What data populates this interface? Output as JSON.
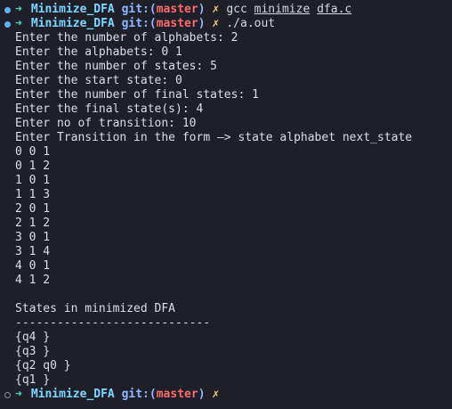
{
  "prompt": {
    "arrow": "➜",
    "dir": "Minimize_DFA",
    "git_label": "git:",
    "open_paren": "(",
    "branch": "master",
    "close_paren": ")",
    "cross": "✗"
  },
  "cmd1": {
    "gcc": "gcc",
    "arg1": "minimize",
    "arg2": "dfa.c"
  },
  "cmd2": {
    "run": "./a.out"
  },
  "output": {
    "l1": "Enter the number of alphabets: 2",
    "l2": "Enter the alphabets: 0 1",
    "l3": "Enter the number of states: 5",
    "l4": "Enter the start state: 0",
    "l5": "Enter the number of final states: 1",
    "l6": "Enter the final state(s): 4",
    "l7": "Enter no of transition: 10",
    "l8": "Enter Transition in the form –> state alphabet next_state",
    "t1": "0 0 1",
    "t2": "0 1 2",
    "t3": "1 0 1",
    "t4": "1 1 3",
    "t5": "2 0 1",
    "t6": "2 1 2",
    "t7": "3 0 1",
    "t8": "3 1 4",
    "t9": "4 0 1",
    "t10": "4 1 2",
    "states_header": "States in minimized DFA",
    "separator": "----------------------------",
    "s1": "{q4 }",
    "s2": "{q3 }",
    "s3": "{q2 q0 }",
    "s4": "{q1 }"
  },
  "colors": {
    "background": "#1e1f28",
    "dir": "#7ad7ff",
    "branch": "#ff6b6b",
    "arrow": "#4fd0c7",
    "cross": "#f0d070"
  }
}
